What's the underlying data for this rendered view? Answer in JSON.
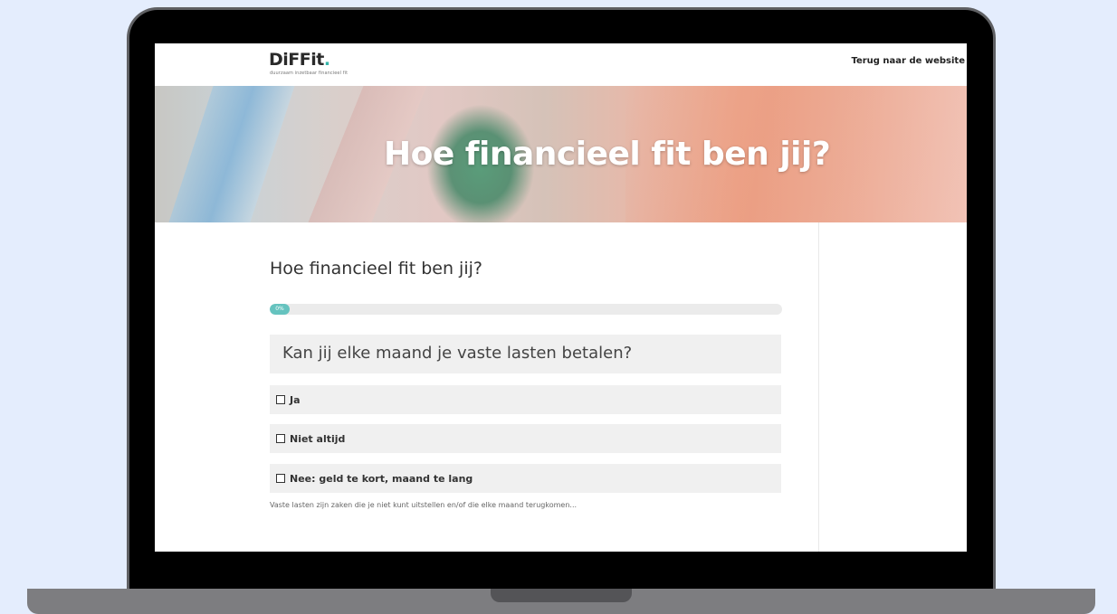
{
  "header": {
    "logo_text": "DiFFit",
    "logo_dot": ".",
    "tagline": "duurzaam inzetbaar financieel fit",
    "back_link": "Terug naar de website"
  },
  "hero": {
    "title": "Hoe financieel fit ben jij?"
  },
  "quiz": {
    "title": "Hoe financieel fit ben jij?",
    "progress_label": "0%",
    "progress_value": 0,
    "question": "Kan jij elke maand je vaste lasten betalen?",
    "options": [
      {
        "label": "Ja"
      },
      {
        "label": "Niet altijd"
      },
      {
        "label": "Nee: geld te kort, maand te lang"
      }
    ],
    "hint": "Vaste lasten zijn zaken die je niet kunt uitstellen en/of die elke maand terugkomen..."
  },
  "colors": {
    "page_bg": "#e4edfd",
    "accent": "#65c3bf",
    "option_bg": "#f0f0f0"
  }
}
